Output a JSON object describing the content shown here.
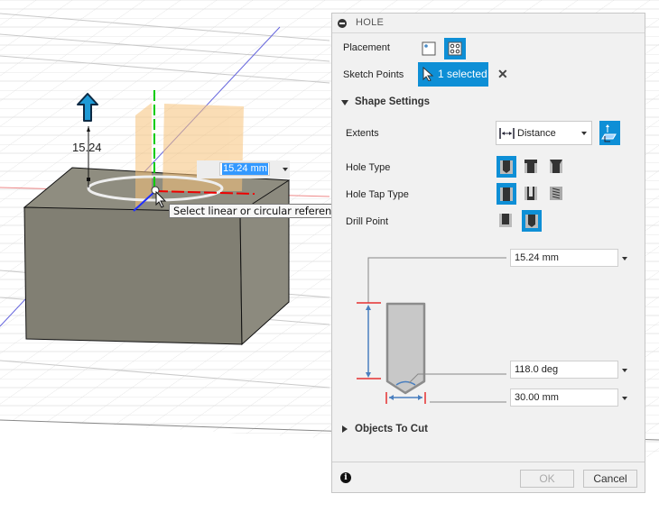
{
  "viewport": {
    "dimension_label": "15.24",
    "inline_input_value": "15.24 mm",
    "tooltip": "Select linear or circular reference edges to fully define hole location"
  },
  "panel": {
    "title": "HOLE",
    "placement": {
      "label": "Placement",
      "options": [
        {
          "name": "single-hole",
          "icon": "single-point-placement-icon",
          "active": false
        },
        {
          "name": "multiple-holes",
          "icon": "sketch-points-placement-icon",
          "active": true
        }
      ]
    },
    "sketch_points": {
      "label": "Sketch Points",
      "selection_label": "1 selected",
      "clear_icon": "close-icon"
    },
    "shape_settings": {
      "label": "Shape Settings",
      "expanded": true,
      "extents": {
        "label": "Extents",
        "value": "Distance",
        "flip_icon": "flip-direction-icon"
      },
      "hole_type": {
        "label": "Hole Type",
        "options": [
          "simple",
          "counterbore",
          "countersink"
        ],
        "selected": "simple"
      },
      "hole_tap_type": {
        "label": "Hole Tap Type",
        "options": [
          "simple",
          "clearance",
          "tapped"
        ],
        "selected": "simple"
      },
      "drill_point": {
        "label": "Drill Point",
        "options": [
          "flat",
          "angle"
        ],
        "selected": "angle"
      },
      "depth": "15.24 mm",
      "point_angle": "118.0 deg",
      "diameter": "30.00 mm"
    },
    "objects_to_cut": {
      "label": "Objects To Cut",
      "expanded": false
    },
    "footer": {
      "ok_label": "OK",
      "cancel_label": "Cancel",
      "ok_enabled": false
    }
  },
  "colors": {
    "accent": "#0e8fd6",
    "axis_x": "#e00000",
    "axis_y": "#00c000",
    "axis_z": "#2020e0",
    "body": "#8a8778",
    "preview": "#f5c77e"
  }
}
